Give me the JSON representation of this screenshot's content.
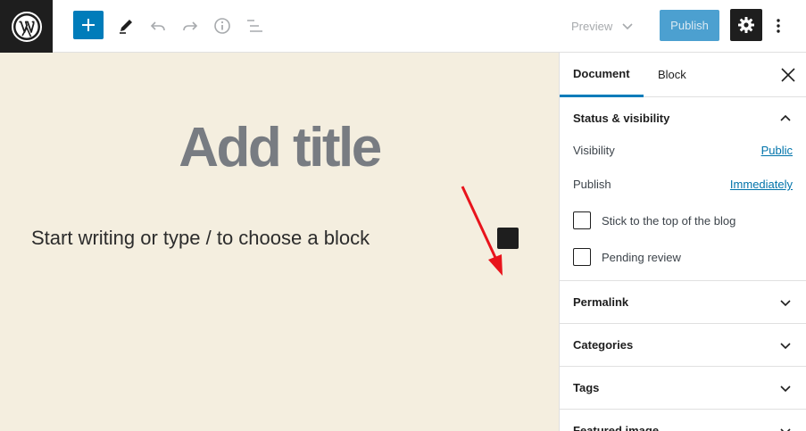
{
  "toolbar": {
    "preview_label": "Preview",
    "publish_label": "Publish",
    "icons": [
      "wordpress-logo",
      "plus-icon",
      "pencil-icon",
      "undo-icon",
      "redo-icon",
      "info-icon",
      "list-view-icon",
      "gear-icon",
      "more-vertical-icon"
    ]
  },
  "editor": {
    "title_placeholder": "Add title",
    "body_placeholder": "Start writing or type / to choose a block",
    "colors": {
      "canvas_bg": "#f4eedf",
      "title_color": "#787c82",
      "annotation_arrow": "#e8141c"
    }
  },
  "sidebar": {
    "tabs": [
      {
        "label": "Document",
        "active": true
      },
      {
        "label": "Block",
        "active": false
      }
    ],
    "status": {
      "heading": "Status & visibility",
      "visibility_label": "Visibility",
      "visibility_value": "Public",
      "publish_label": "Publish",
      "publish_value": "Immediately",
      "sticky_label": "Stick to the top of the blog",
      "pending_label": "Pending review"
    },
    "panels": [
      {
        "label": "Permalink"
      },
      {
        "label": "Categories"
      },
      {
        "label": "Tags"
      },
      {
        "label": "Featured image"
      }
    ]
  },
  "colors": {
    "accent": "#007cba",
    "publish_disabled": "#4ca0d0"
  }
}
